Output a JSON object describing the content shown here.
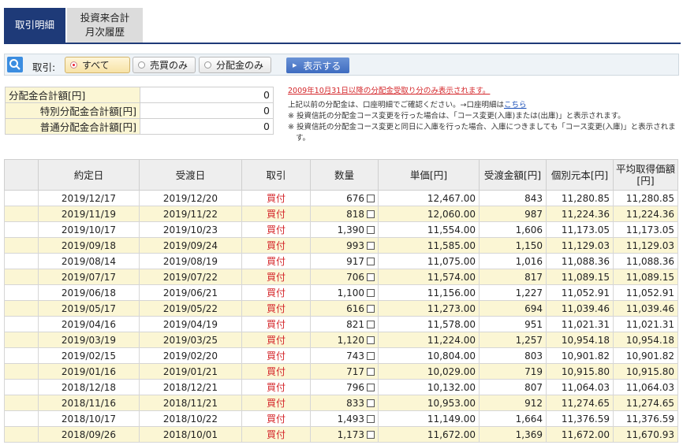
{
  "tabs": [
    {
      "label": "取引明細",
      "active": true
    },
    {
      "label_line1": "投資来合計",
      "label_line2": "月次履歴",
      "active": false
    }
  ],
  "filter": {
    "label": "取引:",
    "options": [
      {
        "label": "すべて",
        "selected": true
      },
      {
        "label": "売買のみ",
        "selected": false
      },
      {
        "label": "分配金のみ",
        "selected": false
      }
    ],
    "show_button": "表示する"
  },
  "summary": [
    {
      "label": "分配金合計額[円]",
      "value": "0"
    },
    {
      "label": "特別分配金合計額[円]",
      "value": "0"
    },
    {
      "label": "普通分配金合計額[円]",
      "value": "0"
    }
  ],
  "notes": {
    "line1": "2009年10月31日以降の分配金受取り分のみ表示されます。",
    "line2_prefix": "上記以前の分配金は、口座明細でご確認ください。→口座明細は",
    "line2_link": "こちら",
    "line3": "※ 投資信託の分配金コース変更を行った場合は、「コース変更(入庫)または(出庫)」と表示されます。",
    "line4": "※ 投資信託の分配金コース変更と同日に入庫を行った場合、入庫につきましても「コース変更(入庫)」と表示されます。"
  },
  "table": {
    "headers": [
      "約定日",
      "受渡日",
      "取引",
      "数量",
      "単価[円]",
      "受渡金額[円]",
      "個別元本[円]",
      "平均取得価額[円]"
    ],
    "rows": [
      {
        "trade_date": "2019/12/17",
        "settle_date": "2019/12/20",
        "type": "買付",
        "qty": "676",
        "price": "12,467.00",
        "amount": "843",
        "cost": "11,280.85",
        "avg": "11,280.85"
      },
      {
        "trade_date": "2019/11/19",
        "settle_date": "2019/11/22",
        "type": "買付",
        "qty": "818",
        "price": "12,060.00",
        "amount": "987",
        "cost": "11,224.36",
        "avg": "11,224.36"
      },
      {
        "trade_date": "2019/10/17",
        "settle_date": "2019/10/23",
        "type": "買付",
        "qty": "1,390",
        "price": "11,554.00",
        "amount": "1,606",
        "cost": "11,173.05",
        "avg": "11,173.05"
      },
      {
        "trade_date": "2019/09/18",
        "settle_date": "2019/09/24",
        "type": "買付",
        "qty": "993",
        "price": "11,585.00",
        "amount": "1,150",
        "cost": "11,129.03",
        "avg": "11,129.03"
      },
      {
        "trade_date": "2019/08/14",
        "settle_date": "2019/08/19",
        "type": "買付",
        "qty": "917",
        "price": "11,075.00",
        "amount": "1,016",
        "cost": "11,088.36",
        "avg": "11,088.36"
      },
      {
        "trade_date": "2019/07/17",
        "settle_date": "2019/07/22",
        "type": "買付",
        "qty": "706",
        "price": "11,574.00",
        "amount": "817",
        "cost": "11,089.15",
        "avg": "11,089.15"
      },
      {
        "trade_date": "2019/06/18",
        "settle_date": "2019/06/21",
        "type": "買付",
        "qty": "1,100",
        "price": "11,156.00",
        "amount": "1,227",
        "cost": "11,052.91",
        "avg": "11,052.91"
      },
      {
        "trade_date": "2019/05/17",
        "settle_date": "2019/05/22",
        "type": "買付",
        "qty": "616",
        "price": "11,273.00",
        "amount": "694",
        "cost": "11,039.46",
        "avg": "11,039.46"
      },
      {
        "trade_date": "2019/04/16",
        "settle_date": "2019/04/19",
        "type": "買付",
        "qty": "821",
        "price": "11,578.00",
        "amount": "951",
        "cost": "11,021.31",
        "avg": "11,021.31"
      },
      {
        "trade_date": "2019/03/19",
        "settle_date": "2019/03/25",
        "type": "買付",
        "qty": "1,120",
        "price": "11,224.00",
        "amount": "1,257",
        "cost": "10,954.18",
        "avg": "10,954.18"
      },
      {
        "trade_date": "2019/02/15",
        "settle_date": "2019/02/20",
        "type": "買付",
        "qty": "743",
        "price": "10,804.00",
        "amount": "803",
        "cost": "10,901.82",
        "avg": "10,901.82"
      },
      {
        "trade_date": "2019/01/16",
        "settle_date": "2019/01/21",
        "type": "買付",
        "qty": "717",
        "price": "10,029.00",
        "amount": "719",
        "cost": "10,915.80",
        "avg": "10,915.80"
      },
      {
        "trade_date": "2018/12/18",
        "settle_date": "2018/12/21",
        "type": "買付",
        "qty": "796",
        "price": "10,132.00",
        "amount": "807",
        "cost": "11,064.03",
        "avg": "11,064.03"
      },
      {
        "trade_date": "2018/11/16",
        "settle_date": "2018/11/21",
        "type": "買付",
        "qty": "833",
        "price": "10,953.00",
        "amount": "912",
        "cost": "11,274.65",
        "avg": "11,274.65"
      },
      {
        "trade_date": "2018/10/17",
        "settle_date": "2018/10/22",
        "type": "買付",
        "qty": "1,493",
        "price": "11,149.00",
        "amount": "1,664",
        "cost": "11,376.59",
        "avg": "11,376.59"
      },
      {
        "trade_date": "2018/09/26",
        "settle_date": "2018/10/01",
        "type": "買付",
        "qty": "1,173",
        "price": "11,672.00",
        "amount": "1,369",
        "cost": "11,672.00",
        "avg": "11,670.93"
      }
    ]
  }
}
